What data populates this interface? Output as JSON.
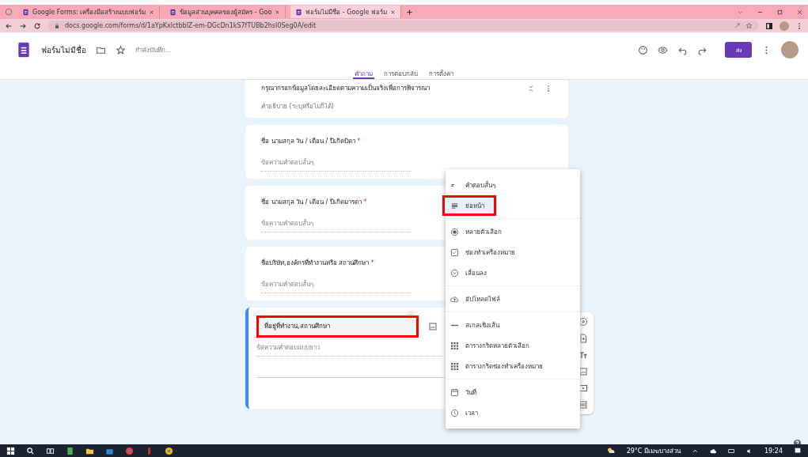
{
  "browser": {
    "tabs": [
      {
        "title": "Google Forms: เครื่องมือสร้างแบบฟอร์ม",
        "selected": false
      },
      {
        "title": "ข้อมูลส่วนบุคคลของผู้สมัคร - Goo",
        "selected": false
      },
      {
        "title": "ฟอร์มไม่มีชื่อ - Google ฟอร์ม",
        "selected": true
      }
    ],
    "address": "docs.google.com/forms/d/1aYpKxlctbblZ-em-DGcDn1kS7fTUBb2hsI0Seg0A/edit"
  },
  "header": {
    "form_title": "ฟอร์มไม่มีชื่อ",
    "save_status": "กำลังบันทึก...",
    "send_button": "ส่ง"
  },
  "form_tabs": [
    {
      "label": "คำถาม",
      "selected": true
    },
    {
      "label": "การตอบกลับ",
      "selected": false
    },
    {
      "label": "การตั้งค่า",
      "selected": false
    }
  ],
  "cards": [
    {
      "kind": "title",
      "title": "กรุณากรอกข้อมูลโดยละเอียดตามความเป็นจริงเพื่อการพิจารณา",
      "description": "คำอธิบาย (ระบุหรือไม่ก็ได้)"
    },
    {
      "kind": "question",
      "title": "ชื่อ นามสกุล วัน / เดือน / ปีเกิดบิดา",
      "required_mark": "*",
      "placeholder": "ข้อความคำตอบสั้นๆ"
    },
    {
      "kind": "question",
      "title": "ชื่อ นามสกุล วัน / เดือน / ปีเกิดมารดา",
      "required_mark": "*",
      "placeholder": "ข้อความคำตอบสั้นๆ"
    },
    {
      "kind": "question",
      "title": "ชื่อบริษัท,องค์กรที่ทำงานหรือ สถานศึกษา",
      "required_mark": "*",
      "placeholder": "ข้อความคำตอบสั้นๆ"
    },
    {
      "kind": "active",
      "title": "ที่อยู่ที่ทำงาน,สถานศึกษา",
      "highlighted": true,
      "placeholder": "ข้อความคำตอบแบบยาว"
    }
  ],
  "type_menu": {
    "groups": [
      [
        {
          "kind": "short",
          "label": "คำตอบสั้นๆ",
          "selected": false,
          "highlighted": false
        },
        {
          "kind": "paragraph",
          "label": "ย่อหน้า",
          "selected": true,
          "highlighted": true
        }
      ],
      [
        {
          "kind": "radio",
          "label": "หลายตัวเลือก",
          "selected": false,
          "highlighted": false
        },
        {
          "kind": "checkbox",
          "label": "ช่องทำเครื่องหมาย",
          "selected": false,
          "highlighted": false
        },
        {
          "kind": "dropdown",
          "label": "เลื่อนลง",
          "selected": false,
          "highlighted": false
        }
      ],
      [
        {
          "kind": "upload",
          "label": "อัปโหลดไฟล์",
          "selected": false,
          "highlighted": false
        }
      ],
      [
        {
          "kind": "scale",
          "label": "สเกลเชิงเส้น",
          "selected": false,
          "highlighted": false
        },
        {
          "kind": "grid",
          "label": "ตารางกริดหลายตัวเลือก",
          "selected": false,
          "highlighted": false
        },
        {
          "kind": "grid",
          "label": "ตารางกริดช่องทำเครื่องหมาย",
          "selected": false,
          "highlighted": false
        }
      ],
      [
        {
          "kind": "date",
          "label": "วันที่",
          "selected": false,
          "highlighted": false
        },
        {
          "kind": "time",
          "label": "เวลา",
          "selected": false,
          "highlighted": false
        }
      ]
    ]
  },
  "taskbar": {
    "weather": "29°C มีเมฆบางส่วน",
    "time": "19:24"
  }
}
